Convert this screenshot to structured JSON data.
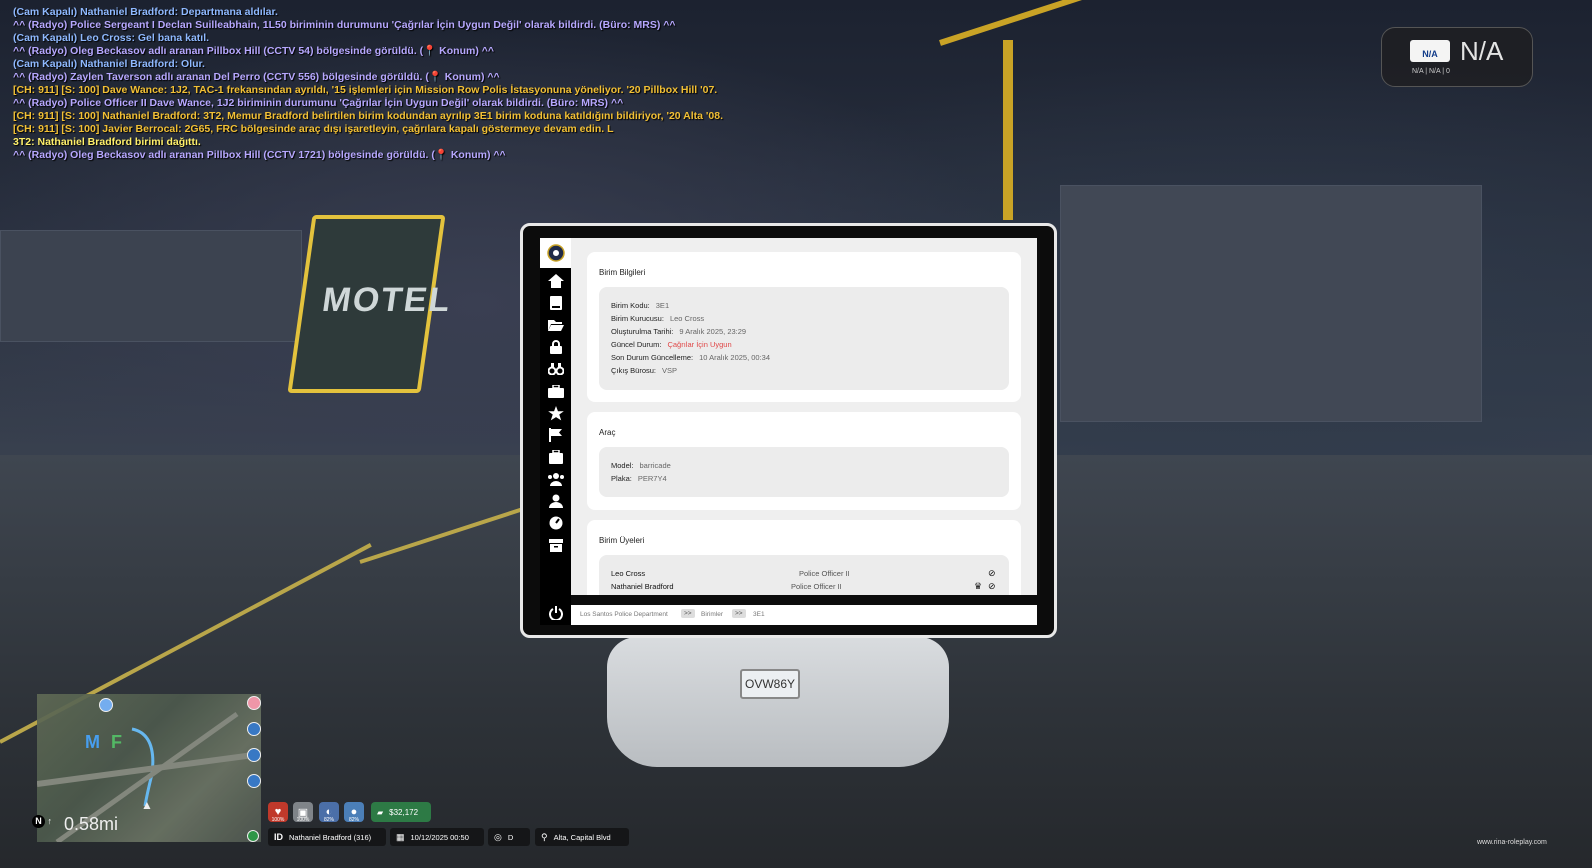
{
  "chat": [
    {
      "cls": "c-blue",
      "text": "(Cam Kapalı) Nathaniel Bradford: Departmana aldılar."
    },
    {
      "cls": "c-radio",
      "text": "^^ (Radyo) Police Sergeant I Declan Suilleabhain, 1L50 biriminin durumunu 'Çağrılar İçin Uygun Değil' olarak bildirdi. (Büro: MRS) ^^"
    },
    {
      "cls": "c-blue",
      "text": "(Cam Kapalı) Leo Cross: Gel bana katıl."
    },
    {
      "cls": "c-radio",
      "text": "^^ (Radyo) Oleg Beckasov adlı aranan Pillbox Hill (CCTV 54) bölgesinde görüldü. (📍 Konum) ^^"
    },
    {
      "cls": "c-blue",
      "text": "(Cam Kapalı) Nathaniel Bradford: Olur."
    },
    {
      "cls": "c-radio",
      "text": "^^ (Radyo) Zaylen Taverson adlı aranan Del Perro (CCTV 556) bölgesinde görüldü. (📍 Konum) ^^"
    },
    {
      "cls": "c-911",
      "text": "[CH: 911] [S: 100] Dave Wance: 1J2, TAC-1 frekansından ayrıldı, '15 işlemleri için Mission Row Polis İstasyonuna yöneliyor. '20 Pillbox Hill '07."
    },
    {
      "cls": "c-radio",
      "text": "^^ (Radyo) Police Officer II Dave Wance, 1J2 biriminin durumunu 'Çağrılar İçin Uygun Değil' olarak bildirdi. (Büro: MRS) ^^"
    },
    {
      "cls": "c-911",
      "text": "[CH: 911] [S: 100] Nathaniel Bradford: 3T2, Memur Bradford belirtilen birim kodundan ayrılıp 3E1 birim koduna katıldığını bildiriyor, '20 Alta '08."
    },
    {
      "cls": "c-911",
      "text": "[CH: 911] [S: 100] Javier Berrocal: 2G65, FRC bölgesinde araç dışı işaretleyin, çağrılara kapalı göstermeye devam edin. L"
    },
    {
      "cls": "c-yellow",
      "text": "3T2: Nathaniel Bradford birimi dağıttı."
    },
    {
      "cls": "c-radio",
      "text": "^^ (Radyo) Oleg Beckasov adlı aranan Pillbox Hill (CCTV 1721) bölgesinde görüldü. (📍 Konum) ^^"
    }
  ],
  "plate_widget": {
    "mini_plate": "N/A",
    "value": "N/A",
    "sub": "N/A | N/A | 0"
  },
  "unit_info": {
    "title": "Birim Bilgileri",
    "rows": [
      {
        "label": "Birim Kodu:",
        "value": "3E1"
      },
      {
        "label": "Birim Kurucusu:",
        "value": "Leo Cross"
      },
      {
        "label": "Oluşturulma Tarihi:",
        "value": "9 Aralık 2025, 23:29"
      },
      {
        "label": "Güncel Durum:",
        "value": "Çağrılar İçin Uygun"
      },
      {
        "label": "Son Durum Güncelleme:",
        "value": "10 Aralık 2025, 00:34"
      },
      {
        "label": "Çıkış Bürosu:",
        "value": "VSP"
      }
    ]
  },
  "vehicle": {
    "title": "Araç",
    "rows": [
      {
        "label": "Model:",
        "value": "barricade"
      },
      {
        "label": "Plaka:",
        "value": "PER7Y4"
      }
    ]
  },
  "members": {
    "title": "Birim Üyeleri",
    "list": [
      {
        "name": "Leo Cross",
        "rank": "Police Officer II"
      },
      {
        "name": "Nathaniel Bradford",
        "rank": "Police Officer II"
      }
    ]
  },
  "breadcrumb": [
    "Los Santos Police Department",
    "Birimler",
    "3E1"
  ],
  "breadcrumb_sep": ">>",
  "map": {
    "distance": "0.58mi",
    "north": "N",
    "letters": [
      "M",
      "F"
    ]
  },
  "stats": [
    {
      "icon": "heart-icon",
      "glyph": "♥",
      "label": "100%",
      "color": "#c0392b"
    },
    {
      "icon": "armor-icon",
      "glyph": "▣",
      "label": "100%",
      "color": "#7f8489"
    },
    {
      "icon": "food-icon",
      "glyph": "◐",
      "label": "82%",
      "color": "#4b6fa8"
    },
    {
      "icon": "water-icon",
      "glyph": "💧",
      "label": "82%",
      "color": "#4b7fb8"
    }
  ],
  "money": "$32,172",
  "hud": {
    "player": "Nathaniel Bradford (316)",
    "id_label": "ID",
    "datetime": "10/12/2025 00:50",
    "gear": "D",
    "location": "Alta, Capital Blvd"
  },
  "watermark": "www.rina-roleplay.com",
  "colors": {
    "status_red": "#e04848",
    "money_green": "#2d7a45"
  }
}
